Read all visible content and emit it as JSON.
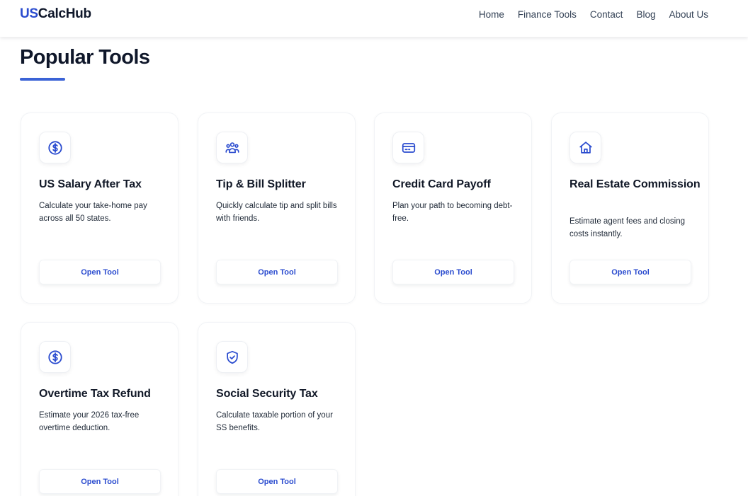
{
  "header": {
    "logo_prefix": "US",
    "logo_suffix": "CalcHub",
    "nav": [
      "Home",
      "Finance Tools",
      "Contact",
      "Blog",
      "About Us"
    ]
  },
  "section": {
    "title": "Popular Tools"
  },
  "tools": [
    {
      "icon": "dollar-circle-icon",
      "title": "US Salary After Tax",
      "description": "Calculate your take-home pay across all 50 states.",
      "button": "Open Tool"
    },
    {
      "icon": "users-icon",
      "title": "Tip & Bill Splitter",
      "description": "Quickly calculate tip and split bills with friends.",
      "button": "Open Tool"
    },
    {
      "icon": "credit-card-icon",
      "title": "Credit Card Payoff",
      "description": "Plan your path to becoming debt-free.",
      "button": "Open Tool"
    },
    {
      "icon": "home-icon",
      "title": "Real Estate Commission",
      "description": "Estimate agent fees and closing costs instantly.",
      "button": "Open Tool"
    },
    {
      "icon": "dollar-circle-icon",
      "title": "Overtime Tax Refund",
      "description": "Estimate your 2026 tax-free overtime deduction.",
      "button": "Open Tool"
    },
    {
      "icon": "shield-check-icon",
      "title": "Social Security Tax",
      "description": "Calculate taxable portion of your SS benefits.",
      "button": "Open Tool"
    }
  ],
  "colors": {
    "brand": "#2b4ccf",
    "accent_underline": "#3b63d6",
    "heading": "#0f172a",
    "nav_text": "#334155"
  }
}
